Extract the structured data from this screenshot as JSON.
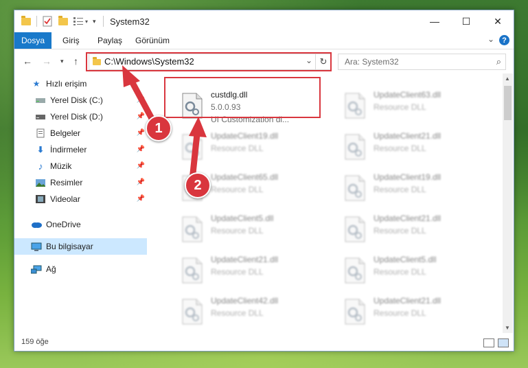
{
  "window": {
    "title": "System32",
    "controls": {
      "minimize": "—",
      "maximize": "☐",
      "close": "✕"
    }
  },
  "ribbon": {
    "file_tab": "Dosya",
    "tabs": [
      "Giriş",
      "Paylaş",
      "Görünüm"
    ],
    "help": "?"
  },
  "navigation": {
    "address": "C:\\Windows\\System32",
    "search_placeholder": "Ara: System32"
  },
  "sidebar": {
    "quick_access": "Hızlı erişim",
    "items": [
      {
        "label": "Yerel Disk (C:)",
        "icon": "drive-icon",
        "pinned": true
      },
      {
        "label": "Yerel Disk (D:)",
        "icon": "drive-icon",
        "pinned": true
      },
      {
        "label": "Belgeler",
        "icon": "documents-icon",
        "pinned": true
      },
      {
        "label": "İndirmeler",
        "icon": "download-icon",
        "pinned": true
      },
      {
        "label": "Müzik",
        "icon": "music-icon",
        "pinned": true
      },
      {
        "label": "Resimler",
        "icon": "pictures-icon",
        "pinned": true
      },
      {
        "label": "Videolar",
        "icon": "videos-icon",
        "pinned": true
      }
    ],
    "onedrive": "OneDrive",
    "this_pc": "Bu bilgisayar",
    "network": "Ağ"
  },
  "files": {
    "highlighted": {
      "name": "custdlg.dll",
      "version": "5.0.0.93",
      "description": "UI Customization di..."
    },
    "column1": [
      {
        "name": "UpdateClient19.dll",
        "type": "Resource DLL"
      },
      {
        "name": "UpdateClient65.dll",
        "type": "Resource DLL"
      },
      {
        "name": "UpdateClient5.dll",
        "type": "Resource DLL"
      },
      {
        "name": "UpdateClient21.dll",
        "type": "Resource DLL"
      },
      {
        "name": "UpdateClient42.dll",
        "type": "Resource DLL"
      }
    ],
    "column2": [
      {
        "name": "UpdateClient63.dll",
        "type": "Resource DLL"
      },
      {
        "name": "UpdateClient21.dll",
        "type": "Resource DLL"
      },
      {
        "name": "UpdateClient19.dll",
        "type": "Resource DLL"
      },
      {
        "name": "UpdateClient21.dll",
        "type": "Resource DLL"
      },
      {
        "name": "UpdateClient5.dll",
        "type": "Resource DLL"
      },
      {
        "name": "UpdateClient21.dll",
        "type": "Resource DLL"
      }
    ]
  },
  "status": {
    "item_count": "159 öğe"
  },
  "annotations": {
    "step1": "1",
    "step2": "2",
    "color": "#d9363e"
  }
}
